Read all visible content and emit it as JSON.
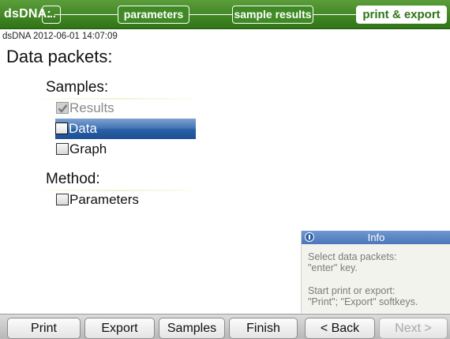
{
  "header": {
    "app_title": "dsDNA:",
    "steps": [
      {
        "label": "...",
        "active": false
      },
      {
        "label": "parameters",
        "active": false
      },
      {
        "label": "sample results",
        "active": false
      },
      {
        "label": "print & export",
        "active": true
      }
    ],
    "color": "#3f8a25"
  },
  "content": {
    "timestamp": "dsDNA 2012-06-01 14:07:09",
    "title": "Data packets:",
    "sections": [
      {
        "label": "Samples:",
        "items": [
          {
            "label": "Results",
            "checked": true,
            "disabled": true,
            "selected": false
          },
          {
            "label": "Data",
            "checked": false,
            "disabled": false,
            "selected": true
          },
          {
            "label": "Graph",
            "checked": false,
            "disabled": false,
            "selected": false
          }
        ]
      },
      {
        "label": "Method:",
        "items": [
          {
            "label": "Parameters",
            "checked": false,
            "disabled": false,
            "selected": false
          }
        ]
      }
    ],
    "selection_color": "#2a5ea5"
  },
  "info": {
    "title": "Info",
    "icon": "info-icon",
    "line1": "Select data packets:",
    "line2": "\"enter\" key.",
    "line3": "Start print or export:",
    "line4": "\"Print\"; \"Export\" softkeys."
  },
  "softkeys": [
    {
      "label": "Print",
      "enabled": true
    },
    {
      "label": "Export",
      "enabled": true
    },
    {
      "label": "Samples",
      "enabled": true
    },
    {
      "label": "Finish",
      "enabled": true
    },
    {
      "label": "< Back",
      "enabled": true
    },
    {
      "label": "Next >",
      "enabled": false
    }
  ]
}
